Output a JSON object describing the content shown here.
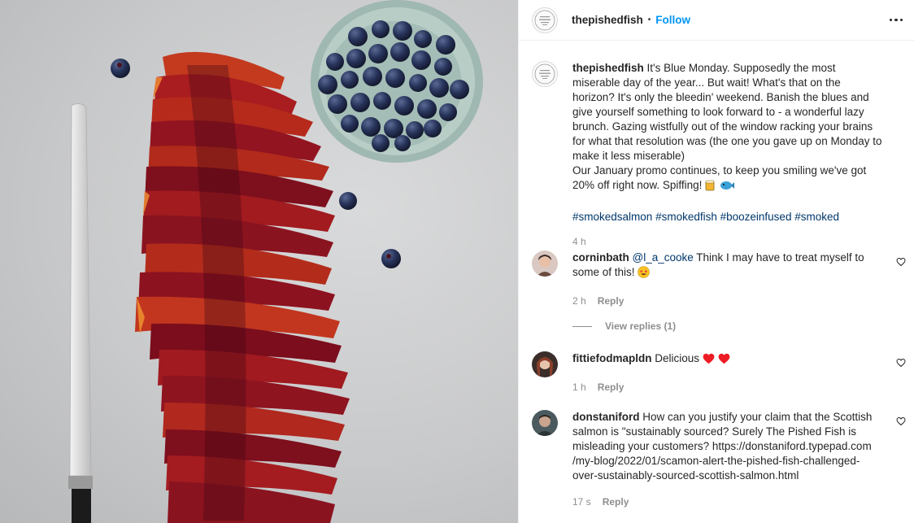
{
  "header": {
    "username": "thepishedfish",
    "separator": "•",
    "follow_label": "Follow",
    "more_icon": "more-options-icon"
  },
  "caption": {
    "username": "thepishedfish",
    "text1": "It's Blue Monday. Supposedly the most miserable day of the year... But wait! What's that on the horizon? It's only the bleedin' weekend. Banish the blues and give yourself something to look forward to - a wonderful lazy brunch. Gazing wistfully out of the window racking your brains for what that resolution was (the one you gave up on Monday to make it less miserable)",
    "text2": "Our January promo continues, to keep you smiling we've got 20% off right now. Spiffing!",
    "hashtags": [
      "#smokedsalmon",
      "#smokedfish",
      "#boozeinfused",
      "#smoked"
    ],
    "time": "4 h"
  },
  "comments": [
    {
      "username": "corninbath",
      "mention": "@l_a_cooke",
      "text": "Think I may have to treat myself to some of this!",
      "time": "2 h",
      "reply_label": "Reply",
      "view_replies": "View replies (1)"
    },
    {
      "username": "fittiefodmapldn",
      "text": "Delicious",
      "time": "1 h",
      "reply_label": "Reply"
    },
    {
      "username": "donstaniford",
      "text": "How can you justify your claim that the Scottish salmon is \"sustainably sourced? Surely The Pished Fish is misleading your customers? https://donstaniford.typepad.com/my-blog/2022/01/scamon-alert-the-pished-fish-challenged-over-sustainably-sourced-scottish-salmon.html",
      "text_lines": [
        "How can you justify your claim that the Scottish",
        "salmon is \"sustainably sourced? Surely The Pished Fish is",
        "misleading your customers? https://donstaniford.typepad.com",
        "/my-blog/2022/01/scamon-alert-the-pished-fish-challenged-",
        "over-sustainably-sourced-scottish-salmon.html"
      ],
      "time": "17 s",
      "reply_label": "Reply"
    }
  ],
  "colors": {
    "follow": "#0095f6",
    "tag": "#00376b",
    "muted": "#8e8e8e",
    "heart": "#ed1c24"
  }
}
